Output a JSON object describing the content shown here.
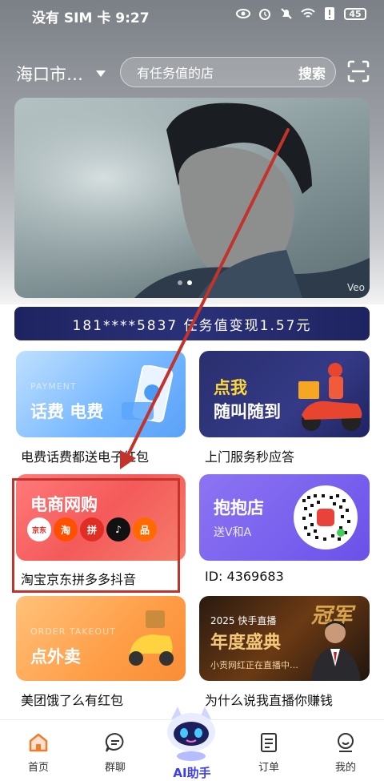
{
  "status_bar": {
    "left_text": "没有 SIM 卡 9:27",
    "battery": "45"
  },
  "header": {
    "location": "海口市…",
    "search_placeholder": "有任务值的店",
    "search_button": "搜索"
  },
  "banner": {
    "watermark": "Veo",
    "dot_count": 2,
    "active_dot": 1
  },
  "earnings": {
    "text": "181****5837 任务值变现1.57元"
  },
  "cards": [
    {
      "sub": "PAYMENT",
      "title": "话费 电费",
      "caption": "电费话费都送电子红包"
    },
    {
      "title_line1": "点我",
      "title_line2": "随叫随到",
      "caption": "上门服务秒应答"
    },
    {
      "title": "电商网购",
      "caption": "淘宝京东拼多多抖音",
      "platforms": [
        {
          "label": "京东",
          "icon": "jd-dog-icon"
        },
        {
          "label": "淘",
          "icon": "taobao-icon"
        },
        {
          "label": "拼",
          "icon": "pinduoduo-icon"
        },
        {
          "label": "♪",
          "icon": "douyin-icon"
        },
        {
          "label": "品",
          "icon": "meituan-icon"
        }
      ]
    },
    {
      "title": "抱抱店",
      "sub": "送V和A",
      "caption": "ID: 4369683"
    },
    {
      "sub": "ORDER TAKEOUT",
      "title": "点外卖",
      "caption": "美团饿了么有红包"
    },
    {
      "title_line1": "2025 快手直播",
      "title_line2": "年度盛典",
      "badge": "冠军",
      "sub": "小贡网红正在直播中…",
      "caption": "为什么说我直播你赚钱"
    }
  ],
  "tab_bar": {
    "items": [
      {
        "label": "首页",
        "icon": "home-icon",
        "active": true
      },
      {
        "label": "群聊",
        "icon": "chat-icon",
        "active": false
      },
      {
        "label": "AI助手",
        "icon": "ai-robot-icon",
        "active": false
      },
      {
        "label": "订单",
        "icon": "order-icon",
        "active": false
      },
      {
        "label": "我的",
        "icon": "profile-icon",
        "active": false
      }
    ]
  },
  "colors": {
    "accent": "#f07c2a",
    "ai_label": "#3a3df0",
    "earn_strip": "#1e2460",
    "highlight": "#c2332b"
  }
}
